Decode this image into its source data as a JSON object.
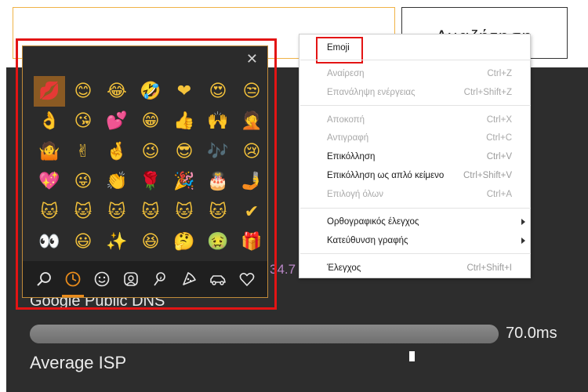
{
  "page": {
    "search_button_label": "Αναζήτηση",
    "partial_value": "34.7",
    "dns_label": "Google Public DNS",
    "isp_value": "70.0ms",
    "isp_label": "Average ISP",
    "isp_bar_fraction": 1.0
  },
  "emoji_panel": {
    "close_glyph": "✕",
    "emojis": [
      {
        "char": "💋",
        "name": "kiss-mark"
      },
      {
        "char": "😊",
        "name": "smiling-face"
      },
      {
        "char": "😂",
        "name": "tears-of-joy"
      },
      {
        "char": "🤣",
        "name": "rolling-laughing"
      },
      {
        "char": "❤",
        "name": "red-heart"
      },
      {
        "char": "😍",
        "name": "heart-eyes"
      },
      {
        "char": "😒",
        "name": "unamused-face"
      },
      {
        "char": "👌",
        "name": "ok-hand"
      },
      {
        "char": "😘",
        "name": "blowing-kiss"
      },
      {
        "char": "💕",
        "name": "two-hearts"
      },
      {
        "char": "😁",
        "name": "grinning-face"
      },
      {
        "char": "👍",
        "name": "thumbs-up"
      },
      {
        "char": "🙌",
        "name": "raising-hands"
      },
      {
        "char": "🤦",
        "name": "facepalm"
      },
      {
        "char": "🤷",
        "name": "shrug"
      },
      {
        "char": "✌",
        "name": "victory-hand"
      },
      {
        "char": "🤞",
        "name": "crossed-fingers"
      },
      {
        "char": "😉",
        "name": "winking-face"
      },
      {
        "char": "😎",
        "name": "sunglasses-face"
      },
      {
        "char": "🎶",
        "name": "musical-notes"
      },
      {
        "char": "😢",
        "name": "crying-face"
      },
      {
        "char": "💖",
        "name": "sparkling-heart"
      },
      {
        "char": "😜",
        "name": "winking-tongue"
      },
      {
        "char": "👏",
        "name": "clapping-hands"
      },
      {
        "char": "🌹",
        "name": "rose"
      },
      {
        "char": "🎉",
        "name": "party-popper"
      },
      {
        "char": "🎂",
        "name": "birthday-cake"
      },
      {
        "char": "🤳",
        "name": "selfie"
      },
      {
        "char": "🐱",
        "name": "ninja-cat"
      },
      {
        "char": "🐱",
        "name": "astro-cat"
      },
      {
        "char": "🐱",
        "name": "hacker-cat"
      },
      {
        "char": "🐱",
        "name": "dino-cat"
      },
      {
        "char": "🐱",
        "name": "stunt-cat"
      },
      {
        "char": "🐱",
        "name": "hipster-cat"
      },
      {
        "char": "✔",
        "name": "check-mark"
      },
      {
        "char": "👀",
        "name": "eyes"
      },
      {
        "char": "😃",
        "name": "grinning-big-eyes"
      },
      {
        "char": "✨",
        "name": "sparkles"
      },
      {
        "char": "😆",
        "name": "squinting-face"
      },
      {
        "char": "🤔",
        "name": "thinking-face"
      },
      {
        "char": "🤢",
        "name": "nauseated-face"
      },
      {
        "char": "🎁",
        "name": "wrapped-gift"
      }
    ],
    "tabs": [
      {
        "name": "search",
        "active": false
      },
      {
        "name": "recent",
        "active": true
      },
      {
        "name": "smileys",
        "active": false
      },
      {
        "name": "people",
        "active": false
      },
      {
        "name": "celebration",
        "active": false
      },
      {
        "name": "food",
        "active": false
      },
      {
        "name": "travel",
        "active": false
      },
      {
        "name": "symbols",
        "active": false
      }
    ]
  },
  "context_menu": {
    "emoji": "Emoji",
    "undo": "Αναίρεση",
    "undo_sc": "Ctrl+Z",
    "redo": "Επανάληψη ενέργειας",
    "redo_sc": "Ctrl+Shift+Z",
    "cut": "Αποκοπή",
    "cut_sc": "Ctrl+X",
    "copy": "Αντιγραφή",
    "copy_sc": "Ctrl+C",
    "paste": "Επικόλληση",
    "paste_sc": "Ctrl+V",
    "paste_plain": "Επικόλληση ως απλό κείμενο",
    "paste_plain_sc": "Ctrl+Shift+V",
    "select_all": "Επιλογή όλων",
    "select_all_sc": "Ctrl+A",
    "spellcheck": "Ορθογραφικός έλεγχος",
    "writing_direction": "Κατεύθυνση γραφής",
    "inspect": "Έλεγχος",
    "inspect_sc": "Ctrl+Shift+I"
  },
  "colors": {
    "highlight_red": "#e31414",
    "panel_bg": "#2b2b2b",
    "accent_orange": "#e88b1c"
  }
}
